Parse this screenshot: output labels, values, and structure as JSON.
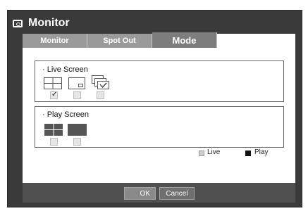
{
  "window": {
    "title": "Monitor",
    "icon": "monitor-icon"
  },
  "tabs": [
    {
      "label": "Monitor",
      "active": false
    },
    {
      "label": "Spot Out",
      "active": false
    },
    {
      "label": "Mode",
      "active": true
    }
  ],
  "live_screen": {
    "title": "· Live Screen",
    "options": [
      {
        "icon": "quad-split-icon",
        "checked": true
      },
      {
        "icon": "pip-icon",
        "checked": false
      },
      {
        "icon": "sequence-icon",
        "checked": false
      }
    ]
  },
  "play_screen": {
    "title": "· Play Screen",
    "options": [
      {
        "icon": "quad-split-filled-icon",
        "checked": false
      },
      {
        "icon": "single-filled-icon",
        "checked": false
      }
    ]
  },
  "legend": [
    {
      "label": "Live",
      "color": "#cfcfcf"
    },
    {
      "label": "Play",
      "color": "#111111"
    }
  ],
  "buttons": {
    "ok": "OK",
    "cancel": "Cancel"
  }
}
